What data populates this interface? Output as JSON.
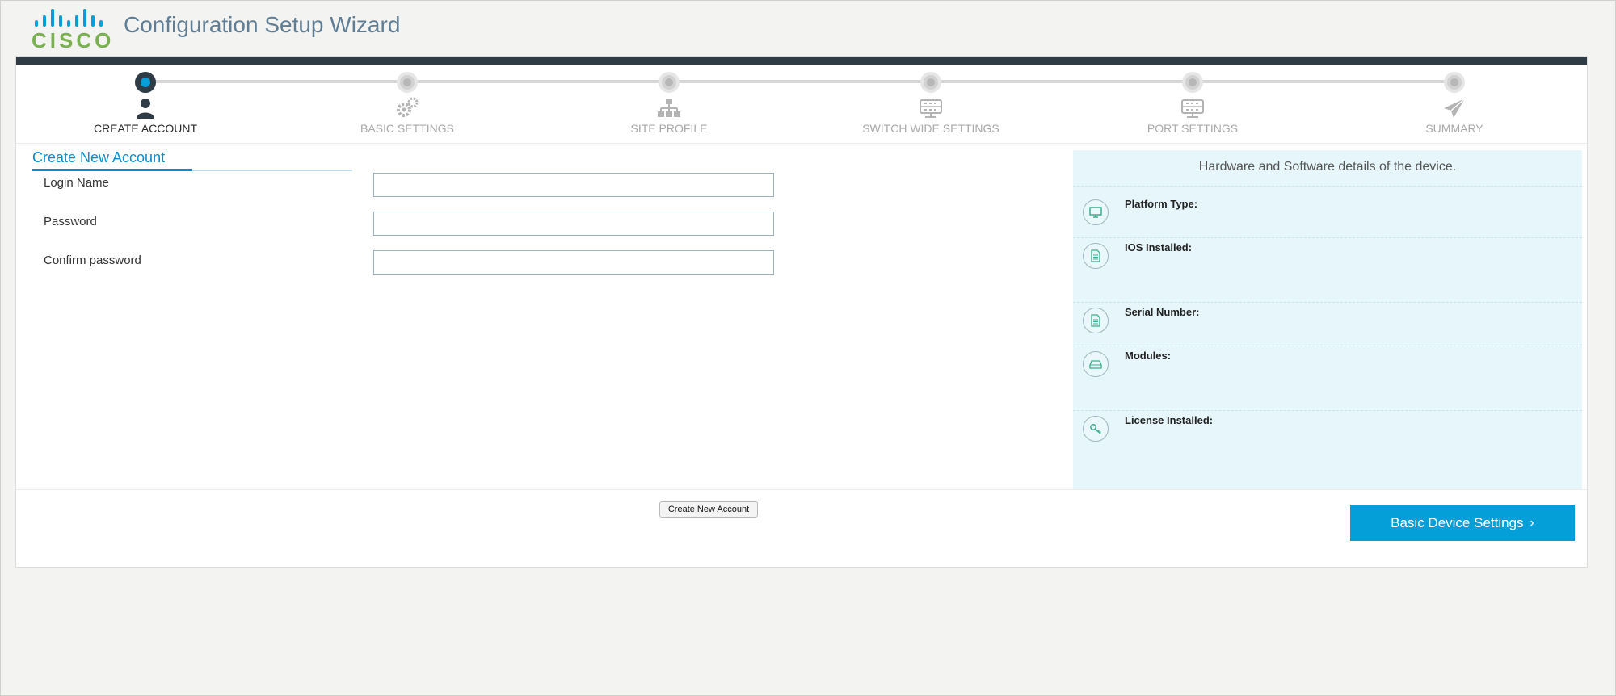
{
  "app": {
    "logo_text": "CISCO",
    "title": "Configuration Setup Wizard"
  },
  "steps": [
    {
      "label": "CREATE ACCOUNT",
      "icon": "user-icon",
      "active": true
    },
    {
      "label": "BASIC SETTINGS",
      "icon": "gears-icon",
      "active": false
    },
    {
      "label": "SITE PROFILE",
      "icon": "sitemap-icon",
      "active": false
    },
    {
      "label": "SWITCH WIDE SETTINGS",
      "icon": "switch-icon",
      "active": false
    },
    {
      "label": "PORT SETTINGS",
      "icon": "switch-icon",
      "active": false
    },
    {
      "label": "SUMMARY",
      "icon": "paper-plane-icon",
      "active": false
    }
  ],
  "form": {
    "section_title": "Create New Account",
    "fields": [
      {
        "label": "Login Name",
        "value": "",
        "placeholder": ""
      },
      {
        "label": "Password",
        "value": "",
        "placeholder": ""
      },
      {
        "label": "Confirm password",
        "value": "",
        "placeholder": ""
      }
    ],
    "submit_label": "Create New Account"
  },
  "info_panel": {
    "title": "Hardware and Software details of the device.",
    "rows": [
      {
        "label": "Platform Type:",
        "icon": "monitor-icon"
      },
      {
        "label": "IOS Installed:",
        "icon": "document-icon"
      },
      {
        "label": "Serial Number:",
        "icon": "document-icon"
      },
      {
        "label": "Modules:",
        "icon": "drive-icon"
      },
      {
        "label": "License Installed:",
        "icon": "key-icon"
      }
    ]
  },
  "nav": {
    "next_label": "Basic Device Settings",
    "next_chevron": "›"
  },
  "colors": {
    "accent": "#049fd9",
    "dark_bar": "#2f3b45",
    "title": "#5f7d94",
    "logo_green": "#7ab051",
    "panel_bg": "#e6f6fb"
  }
}
